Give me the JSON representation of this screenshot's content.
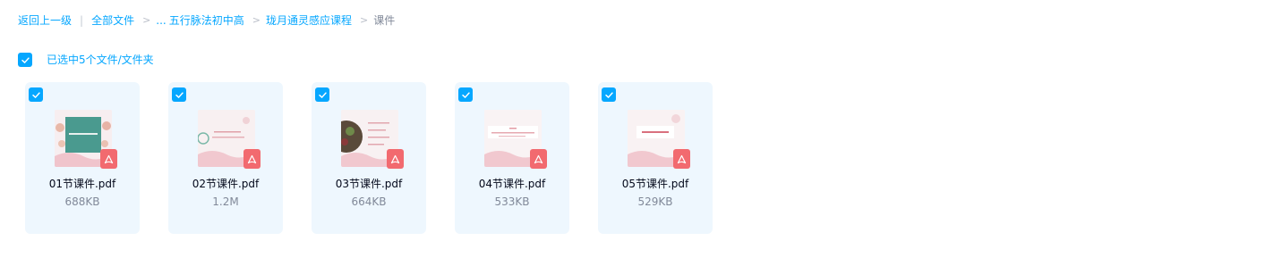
{
  "breadcrumb": {
    "back_label": "返回上一级",
    "all_files_label": "全部文件",
    "ellipsis": "...",
    "folder_1": "五行脉法初中高",
    "folder_2": "珑月通灵感应课程",
    "current": "课件",
    "separator": ">",
    "pipe": "|"
  },
  "selection": {
    "label": "已选中5个文件/文件夹",
    "checked": true
  },
  "files": [
    {
      "name": "01节课件.pdf",
      "size": "688KB",
      "checked": true,
      "icon": "pdf-icon"
    },
    {
      "name": "02节课件.pdf",
      "size": "1.2M",
      "checked": true,
      "icon": "pdf-icon"
    },
    {
      "name": "03节课件.pdf",
      "size": "664KB",
      "checked": true,
      "icon": "pdf-icon"
    },
    {
      "name": "04节课件.pdf",
      "size": "533KB",
      "checked": true,
      "icon": "pdf-icon"
    },
    {
      "name": "05节课件.pdf",
      "size": "529KB",
      "checked": true,
      "icon": "pdf-icon"
    }
  ],
  "colors": {
    "accent": "#06a7ff",
    "card_background": "#eef7fe",
    "pdf_red": "#f26a6f",
    "muted_text": "#818999"
  }
}
